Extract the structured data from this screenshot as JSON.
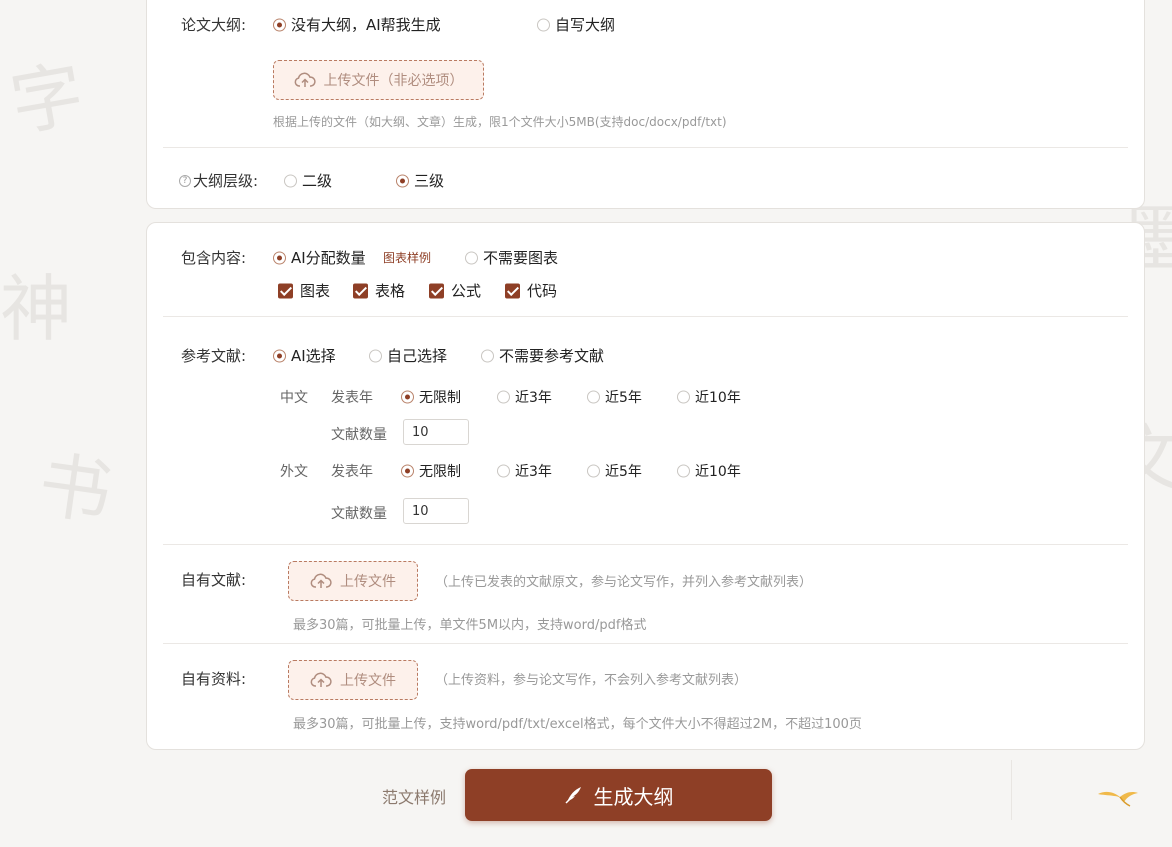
{
  "outline": {
    "label": "论文大纲:",
    "option_ai": "没有大纲，AI帮我生成",
    "option_self": "自写大纲",
    "upload_label": "上传文件（非必选项）",
    "upload_hint": "根据上传的文件（如大纲、文章）生成，限1个文件大小5MB(支持doc/docx/pdf/txt)"
  },
  "levels": {
    "help": "?",
    "label": "大纲层级:",
    "option_2": "二级",
    "option_3": "三级"
  },
  "content": {
    "label": "包含内容:",
    "option_ai": "AI分配数量",
    "sample_link": "图表样例",
    "option_none": "不需要图表",
    "checks": [
      "图表",
      "表格",
      "公式",
      "代码"
    ]
  },
  "refs": {
    "label": "参考文献:",
    "option_ai": "AI选择",
    "option_self": "自己选择",
    "option_none": "不需要参考文献",
    "cn_label": "中文",
    "en_label": "外文",
    "year_label": "发表年",
    "count_label": "文献数量",
    "year_options": [
      "无限制",
      "近3年",
      "近5年",
      "近10年"
    ],
    "cn_count": "10",
    "en_count": "10"
  },
  "own_refs": {
    "label": "自有文献:",
    "upload_label": "上传文件",
    "desc": "（上传已发表的文献原文，参与论文写作，并列入参考文献列表）",
    "hint": "最多30篇，可批量上传，单文件5M以内，支持word/pdf格式"
  },
  "own_materials": {
    "label": "自有资料:",
    "upload_label": "上传文件",
    "desc": "（上传资料，参与论文写作，不会列入参考文献列表）",
    "hint": "最多30篇，可批量上传，支持word/pdf/txt/excel格式，每个文件大小不得超过2M，不超过100页"
  },
  "footer": {
    "sample_link": "范文样例",
    "generate_button": "生成大纲"
  }
}
